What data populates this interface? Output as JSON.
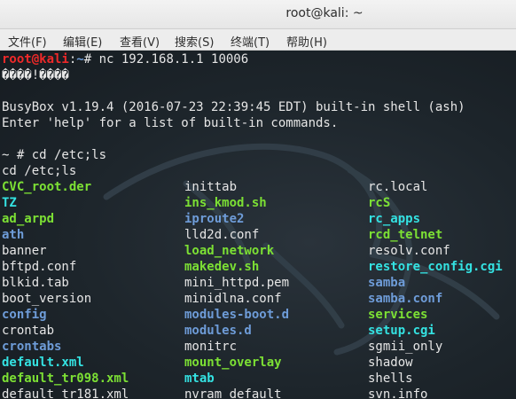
{
  "window": {
    "title": "root@kali: ~"
  },
  "menu": [
    "文件(F)",
    "编辑(E)",
    "查看(V)",
    "搜索(S)",
    "终端(T)",
    "帮助(H)"
  ],
  "terminal": {
    "prompt_user": "root@kali",
    "prompt_sep": ":",
    "prompt_path": "~",
    "prompt_end": "# ",
    "command": "nc 192.168.1.1 10006",
    "garbled": "����!����",
    "busybox_line": "BusyBox v1.19.4 (2016-07-23 22:39:45 EDT) built-in shell (ash)",
    "help_line": "Enter 'help' for a list of built-in commands.",
    "remote_prompt": "~ # cd /etc;ls",
    "echo_line": "cd /etc;ls",
    "listing": [
      {
        "name": "CVC_root.der",
        "color": "green"
      },
      {
        "name": "inittab",
        "color": "file"
      },
      {
        "name": "rc.local",
        "color": "file"
      },
      {
        "name": "TZ",
        "color": "cyan"
      },
      {
        "name": "ins_kmod.sh",
        "color": "green"
      },
      {
        "name": "rcS",
        "color": "green"
      },
      {
        "name": "ad_arpd",
        "color": "green"
      },
      {
        "name": "iproute2",
        "color": "blue"
      },
      {
        "name": "rc_apps",
        "color": "cyan"
      },
      {
        "name": "ath",
        "color": "blue"
      },
      {
        "name": "lld2d.conf",
        "color": "file"
      },
      {
        "name": "rcd_telnet",
        "color": "green"
      },
      {
        "name": "banner",
        "color": "file"
      },
      {
        "name": "load_network",
        "color": "green"
      },
      {
        "name": "resolv.conf",
        "color": "file"
      },
      {
        "name": "bftpd.conf",
        "color": "file"
      },
      {
        "name": "makedev.sh",
        "color": "green"
      },
      {
        "name": "restore_config.cgi",
        "color": "cyan"
      },
      {
        "name": "blkid.tab",
        "color": "file"
      },
      {
        "name": "mini_httpd.pem",
        "color": "file"
      },
      {
        "name": "samba",
        "color": "blue"
      },
      {
        "name": "boot_version",
        "color": "file"
      },
      {
        "name": "minidlna.conf",
        "color": "file"
      },
      {
        "name": "samba.conf",
        "color": "blue"
      },
      {
        "name": "config",
        "color": "blue"
      },
      {
        "name": "modules-boot.d",
        "color": "blue"
      },
      {
        "name": "services",
        "color": "green"
      },
      {
        "name": "crontab",
        "color": "file"
      },
      {
        "name": "modules.d",
        "color": "blue"
      },
      {
        "name": "setup.cgi",
        "color": "cyan"
      },
      {
        "name": "crontabs",
        "color": "blue"
      },
      {
        "name": "monitrc",
        "color": "file"
      },
      {
        "name": "sgmii_only",
        "color": "file"
      },
      {
        "name": "default.xml",
        "color": "cyan"
      },
      {
        "name": "mount_overlay",
        "color": "green"
      },
      {
        "name": "shadow",
        "color": "file"
      },
      {
        "name": "default_tr098.xml",
        "color": "green"
      },
      {
        "name": "mtab",
        "color": "cyan"
      },
      {
        "name": "shells",
        "color": "file"
      },
      {
        "name": "default_tr181.xml",
        "color": "file"
      },
      {
        "name": "nvram_default",
        "color": "file"
      },
      {
        "name": "svn.info",
        "color": "file"
      }
    ]
  }
}
